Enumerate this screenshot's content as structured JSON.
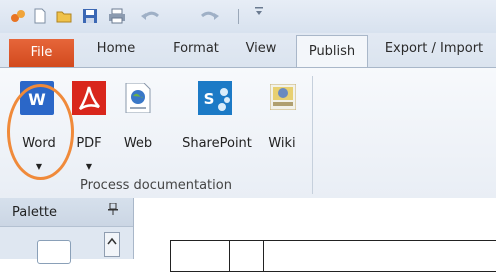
{
  "quick_access": {
    "icons": [
      "app-icon",
      "new-document-icon",
      "open-folder-icon",
      "save-icon",
      "print-icon",
      "undo-icon",
      "redo-icon"
    ]
  },
  "tabs": {
    "file": "File",
    "home": "Home",
    "format": "Format",
    "view": "View",
    "publish": "Publish",
    "export_import": "Export / Import"
  },
  "ribbon": {
    "buttons": {
      "word": "Word",
      "pdf": "PDF",
      "web": "Web",
      "sharepoint": "SharePoint",
      "wiki": "Wiki"
    },
    "group_label": "Process documentation"
  },
  "palette": {
    "title": "Palette"
  },
  "colors": {
    "file_tab": "#d24a1e",
    "word_blue": "#2b67c8",
    "pdf_red": "#d9261c",
    "sharepoint_blue": "#1c7ac6",
    "highlight": "#f08a3a"
  }
}
